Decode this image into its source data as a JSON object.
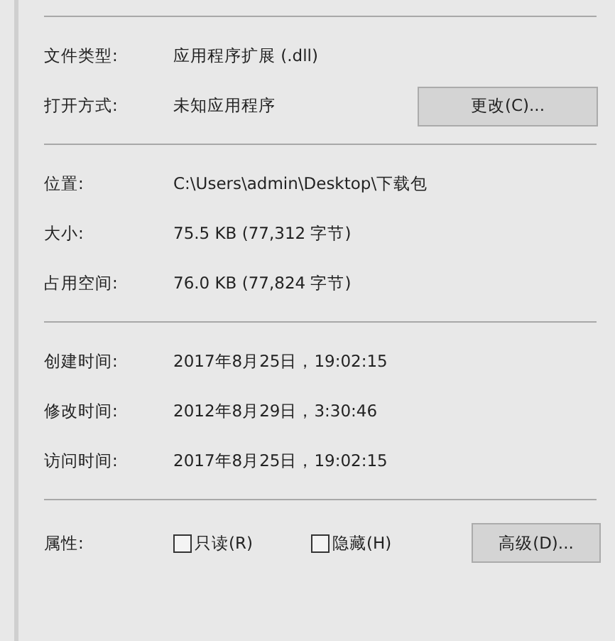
{
  "sections": [
    {
      "rows": [
        {
          "label": "文件类型:",
          "value": "应用程序扩展 (.dll)"
        },
        {
          "label": "打开方式:",
          "value": "未知应用程序",
          "button": "更改(C)..."
        }
      ]
    },
    {
      "rows": [
        {
          "label": "位置:",
          "value": "C:\\Users\\admin\\Desktop\\下载包"
        },
        {
          "label": "大小:",
          "value": "75.5 KB (77,312 字节)"
        },
        {
          "label": "占用空间:",
          "value": "76.0 KB (77,824 字节)"
        }
      ]
    },
    {
      "rows": [
        {
          "label": "创建时间:",
          "value": "2017年8月25日，19:02:15"
        },
        {
          "label": "修改时间:",
          "value": "2012年8月29日，3:30:46"
        },
        {
          "label": "访问时间:",
          "value": "2017年8月25日，19:02:15"
        }
      ]
    }
  ],
  "attributes": {
    "label": "属性:",
    "checkboxes": [
      {
        "label": "只读(R)",
        "checked": false
      },
      {
        "label": "隐藏(H)",
        "checked": false
      }
    ],
    "button": "高级(D)..."
  }
}
